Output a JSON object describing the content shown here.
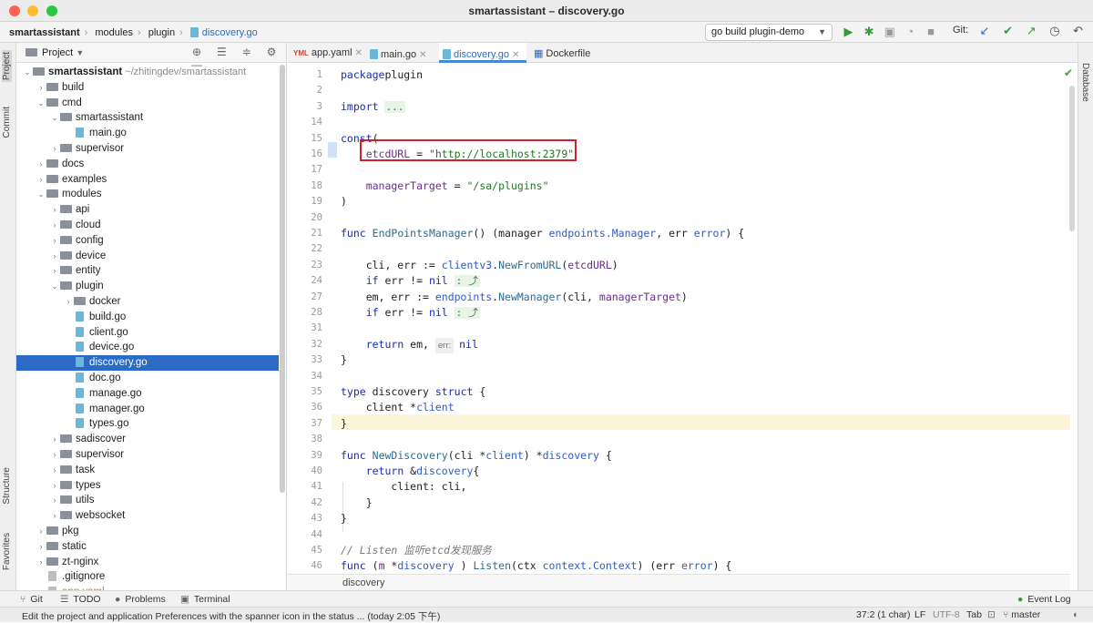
{
  "window": {
    "title": "smartassistant – discovery.go"
  },
  "breadcrumb": [
    "smartassistant",
    "modules",
    "plugin",
    "discovery.go"
  ],
  "toolbar": {
    "run_config": "go build plugin-demo",
    "git_label": "Git:",
    "icons": [
      "run-icon",
      "debug-icon",
      "coverage-icon",
      "profile-icon",
      "stop-icon",
      "update-icon",
      "commit-icon",
      "push-icon",
      "history-icon",
      "rollback-icon",
      "search-icon"
    ]
  },
  "left_strip": {
    "project": "Project",
    "commit": "Commit",
    "structure": "Structure",
    "favorites": "Favorites"
  },
  "right_strip": {
    "database": "Database"
  },
  "project_panel": {
    "title": "Project",
    "tree": [
      {
        "depth": 0,
        "name": "smartassistant",
        "kind": "folder",
        "open": true,
        "extra": "~/zhitingdev/smartassistant",
        "bold": true
      },
      {
        "depth": 1,
        "name": "build",
        "kind": "folder",
        "open": false
      },
      {
        "depth": 1,
        "name": "cmd",
        "kind": "folder",
        "open": true
      },
      {
        "depth": 2,
        "name": "smartassistant",
        "kind": "folder",
        "open": true
      },
      {
        "depth": 3,
        "name": "main.go",
        "kind": "go"
      },
      {
        "depth": 2,
        "name": "supervisor",
        "kind": "folder",
        "open": false
      },
      {
        "depth": 1,
        "name": "docs",
        "kind": "folder",
        "open": false
      },
      {
        "depth": 1,
        "name": "examples",
        "kind": "folder",
        "open": false
      },
      {
        "depth": 1,
        "name": "modules",
        "kind": "folder",
        "open": true
      },
      {
        "depth": 2,
        "name": "api",
        "kind": "folder",
        "open": false
      },
      {
        "depth": 2,
        "name": "cloud",
        "kind": "folder",
        "open": false
      },
      {
        "depth": 2,
        "name": "config",
        "kind": "folder",
        "open": false
      },
      {
        "depth": 2,
        "name": "device",
        "kind": "folder",
        "open": false
      },
      {
        "depth": 2,
        "name": "entity",
        "kind": "folder",
        "open": false
      },
      {
        "depth": 2,
        "name": "plugin",
        "kind": "folder",
        "open": true
      },
      {
        "depth": 3,
        "name": "docker",
        "kind": "folder",
        "open": false
      },
      {
        "depth": 3,
        "name": "build.go",
        "kind": "go"
      },
      {
        "depth": 3,
        "name": "client.go",
        "kind": "go"
      },
      {
        "depth": 3,
        "name": "device.go",
        "kind": "go"
      },
      {
        "depth": 3,
        "name": "discovery.go",
        "kind": "go",
        "selected": true
      },
      {
        "depth": 3,
        "name": "doc.go",
        "kind": "go"
      },
      {
        "depth": 3,
        "name": "manage.go",
        "kind": "go"
      },
      {
        "depth": 3,
        "name": "manager.go",
        "kind": "go"
      },
      {
        "depth": 3,
        "name": "types.go",
        "kind": "go"
      },
      {
        "depth": 2,
        "name": "sadiscover",
        "kind": "folder",
        "open": false
      },
      {
        "depth": 2,
        "name": "supervisor",
        "kind": "folder",
        "open": false
      },
      {
        "depth": 2,
        "name": "task",
        "kind": "folder",
        "open": false
      },
      {
        "depth": 2,
        "name": "types",
        "kind": "folder",
        "open": false
      },
      {
        "depth": 2,
        "name": "utils",
        "kind": "folder",
        "open": false
      },
      {
        "depth": 2,
        "name": "websocket",
        "kind": "folder",
        "open": false
      },
      {
        "depth": 1,
        "name": "pkg",
        "kind": "folder",
        "open": false
      },
      {
        "depth": 1,
        "name": "static",
        "kind": "folder",
        "open": false
      },
      {
        "depth": 1,
        "name": "zt-nginx",
        "kind": "folder",
        "open": false
      },
      {
        "depth": 1,
        "name": ".gitignore",
        "kind": "dot"
      },
      {
        "depth": 1,
        "name": "app.yaml",
        "kind": "dot"
      }
    ]
  },
  "editor": {
    "tabs": [
      {
        "label": "app.yaml",
        "active": false
      },
      {
        "label": "main.go",
        "active": false
      },
      {
        "label": "discovery.go",
        "active": true
      },
      {
        "label": "Dockerfile",
        "active": false
      }
    ],
    "line_numbers": [
      "1",
      "2",
      "3",
      "14",
      "15",
      "16",
      "17",
      "18",
      "19",
      "20",
      "21",
      "22",
      "23",
      "24",
      "27",
      "28",
      "31",
      "32",
      "33",
      "34",
      "35",
      "36",
      "37",
      "38",
      "39",
      "40",
      "41",
      "42",
      "43",
      "44",
      "45",
      "46"
    ],
    "lines": [
      [
        [
          "kw",
          "package"
        ],
        [
          "",
          "plugin"
        ]
      ],
      [],
      [
        [
          "kw",
          "import"
        ],
        [
          "",
          "...fold..."
        ]
      ],
      [],
      [
        [
          "kw",
          "const"
        ],
        [
          "",
          "("
        ]
      ],
      [
        [
          "id",
          "    etcdURL"
        ],
        [
          "",
          " = "
        ],
        [
          "str",
          "\"http://localhost:2379\""
        ]
      ],
      [],
      [
        [
          "id",
          "    managerTarget"
        ],
        [
          "",
          " = "
        ],
        [
          "str",
          "\"/sa/plugins\""
        ]
      ],
      [
        [
          "",
          ")"
        ]
      ],
      [],
      [
        [
          "kw",
          "func"
        ],
        [
          "",
          " "
        ],
        [
          "fn",
          "EndPointsManager"
        ],
        [
          "",
          "() (manager "
        ],
        [
          "ty",
          "endpoints.Manager"
        ],
        [
          "",
          ", err "
        ],
        [
          "ty",
          "error"
        ],
        [
          "",
          ") {"
        ]
      ],
      [],
      [
        [
          "",
          "    cli, err := "
        ],
        [
          "ty",
          "clientv3"
        ],
        [
          "",
          "."
        ],
        [
          "fn",
          "NewFromURL"
        ],
        [
          "",
          "("
        ],
        [
          "id",
          "etcdURL"
        ],
        [
          "",
          ")"
        ]
      ],
      [
        [
          "",
          "    "
        ],
        [
          "kw",
          "if"
        ],
        [
          "",
          " err != "
        ],
        [
          "kw",
          "nil"
        ],
        [
          "",
          " "
        ]
      ],
      [
        [
          "",
          "    em, err := "
        ],
        [
          "ty",
          "endpoints"
        ],
        [
          "",
          "."
        ],
        [
          "fn",
          "NewManager"
        ],
        [
          "",
          "(cli, "
        ],
        [
          "id",
          "managerTarget"
        ],
        [
          "",
          ")"
        ]
      ],
      [
        [
          "",
          "    "
        ],
        [
          "kw",
          "if"
        ],
        [
          "",
          " err != "
        ],
        [
          "kw",
          "nil"
        ],
        [
          "",
          " "
        ]
      ],
      [],
      [
        [
          "",
          "    "
        ],
        [
          "kw",
          "return"
        ],
        [
          "",
          " em, "
        ],
        [
          "hint",
          "err:"
        ],
        [
          "kw",
          "nil"
        ]
      ],
      [
        [
          "",
          "}"
        ]
      ],
      [],
      [
        [
          "kw",
          "type"
        ],
        [
          "",
          " discovery "
        ],
        [
          "kw",
          "struct"
        ],
        [
          "",
          " {"
        ]
      ],
      [
        [
          "",
          "    client *"
        ],
        [
          "ty",
          "client"
        ]
      ],
      [
        [
          "",
          "}"
        ]
      ],
      [],
      [
        [
          "kw",
          "func"
        ],
        [
          "",
          " "
        ],
        [
          "fn",
          "NewDiscovery"
        ],
        [
          "",
          "(cli *"
        ],
        [
          "ty",
          "client"
        ],
        [
          "",
          ") *"
        ],
        [
          "ty",
          "discovery"
        ],
        [
          "",
          " {"
        ]
      ],
      [
        [
          "",
          "    "
        ],
        [
          "kw",
          "return"
        ],
        [
          "",
          " &"
        ],
        [
          "ty",
          "discovery"
        ],
        [
          "",
          "{"
        ]
      ],
      [
        [
          "",
          "        client: cli,"
        ]
      ],
      [
        [
          "",
          "    }"
        ]
      ],
      [
        [
          "",
          "}"
        ]
      ],
      [],
      [
        [
          "cm",
          "// Listen 监听etcd发现服务"
        ]
      ],
      [
        [
          "kw",
          "func"
        ],
        [
          "",
          " ("
        ],
        [
          "id",
          "m"
        ],
        [
          "",
          " *"
        ],
        [
          "ty",
          "discovery"
        ],
        [
          "",
          " ) "
        ],
        [
          "fn",
          "Listen"
        ],
        [
          "",
          "(ctx "
        ],
        [
          "ty",
          "context.Context"
        ],
        [
          "",
          ") (err "
        ],
        [
          "ty",
          "error"
        ],
        [
          "",
          ") {"
        ]
      ]
    ],
    "folds": [
      {
        "line": 2,
        "text": "..."
      },
      {
        "line": 13,
        "text": ": ⤴"
      },
      {
        "line": 15,
        "text": ": ⤴"
      }
    ],
    "breadcrumb": "discovery"
  },
  "bottom_tabs": [
    {
      "label": "Git",
      "icon": "git-branch-icon"
    },
    {
      "label": "TODO",
      "icon": "todo-icon"
    },
    {
      "label": "Problems",
      "icon": "problems-icon"
    },
    {
      "label": "Terminal",
      "icon": "terminal-icon"
    },
    {
      "label": "Event Log",
      "icon": "event-log-icon"
    }
  ],
  "status": {
    "message": "Edit the project and application Preferences with the spanner icon in the status ... (today 2:05 下午)",
    "position": "37:2 (1 char)",
    "line_sep": "LF",
    "encoding": "UTF-8",
    "indent": "Tab",
    "branch": "master"
  },
  "colors": {
    "accent": "#2c6bc5",
    "highlight_box": "#d0212d",
    "string": "#1f7a1f",
    "keyword": "#1a2bb0"
  }
}
